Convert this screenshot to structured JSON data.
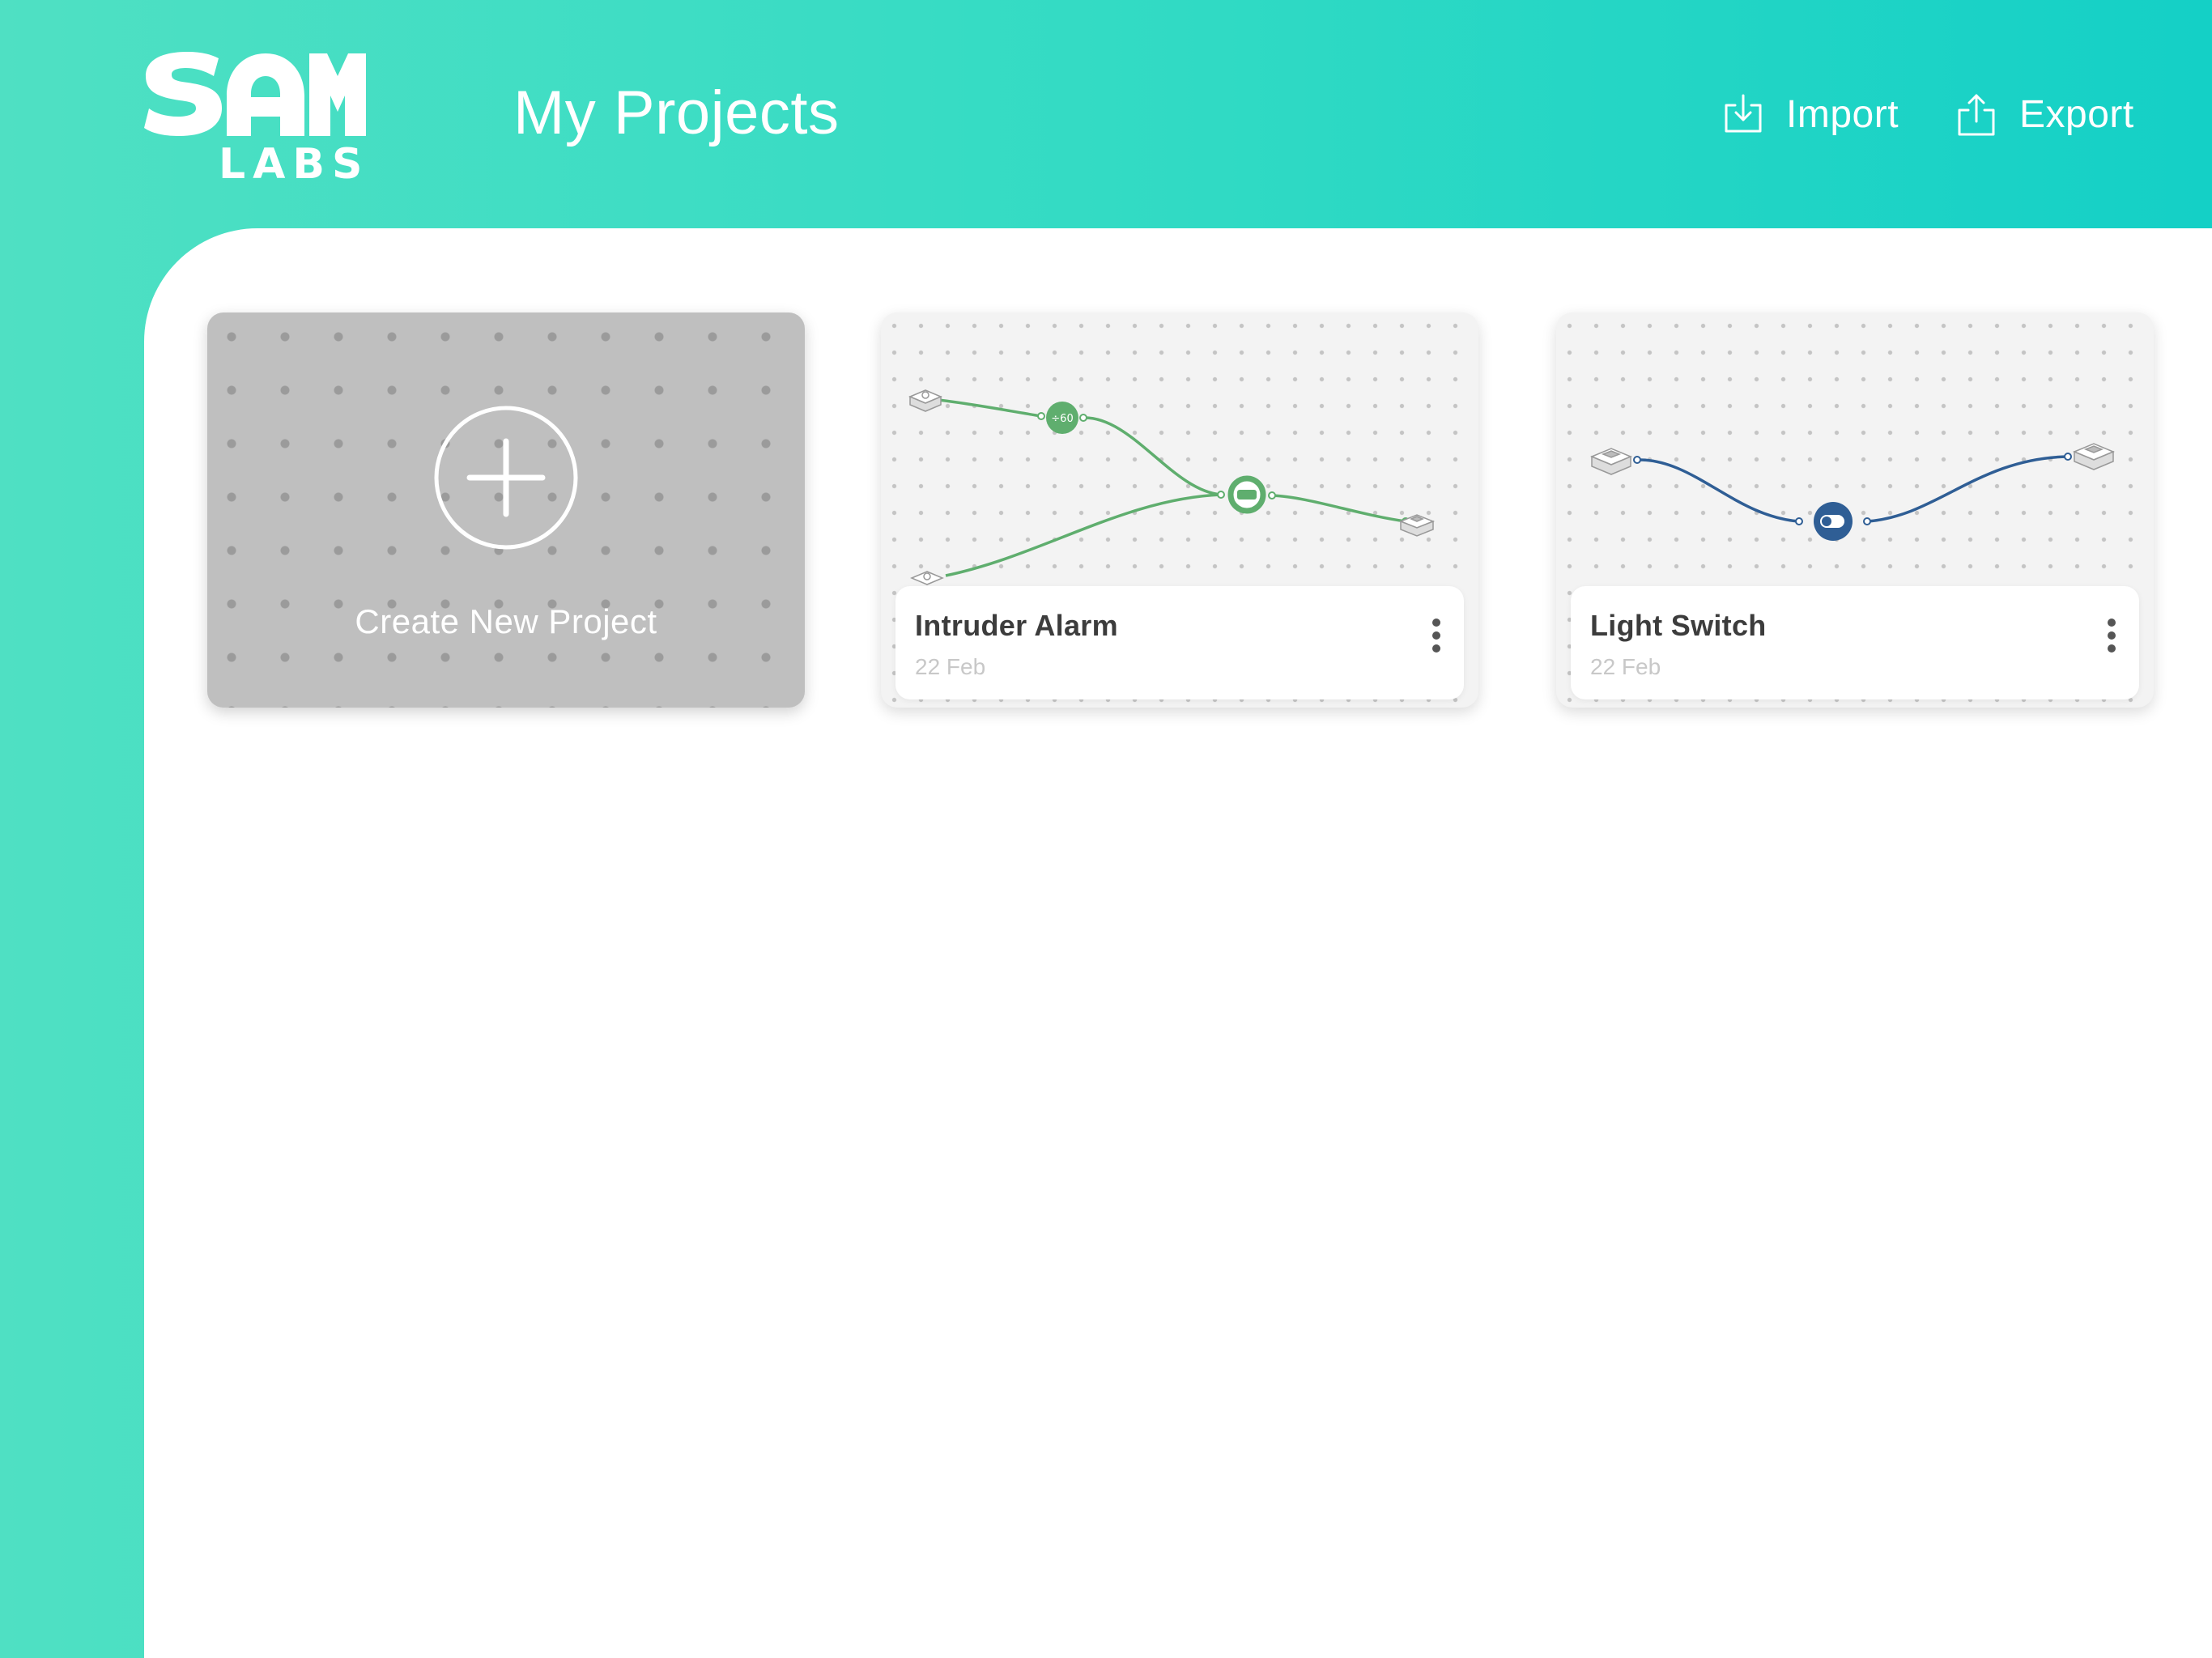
{
  "app": {
    "logo_text": [
      "SAM",
      "LABS"
    ],
    "title": "My Projects"
  },
  "header": {
    "import_label": "Import",
    "import_icon": "import-icon",
    "export_label": "Export",
    "export_icon": "export-icon"
  },
  "create_card": {
    "label": "Create New Project",
    "icon": "plus-circle-icon"
  },
  "projects": [
    {
      "name": "Intruder Alarm",
      "date": "22 Feb",
      "accent": "#5fae6e",
      "menu_icon": "more-vertical-icon"
    },
    {
      "name": "Light Switch",
      "date": "22 Feb",
      "accent": "#2f5e95",
      "menu_icon": "more-vertical-icon"
    }
  ],
  "colors": {
    "header_gradient_start": "#4fe0c3",
    "header_gradient_end": "#14d0c6",
    "create_card_bg": "#bfbfbf",
    "content_bg": "#ffffff"
  }
}
